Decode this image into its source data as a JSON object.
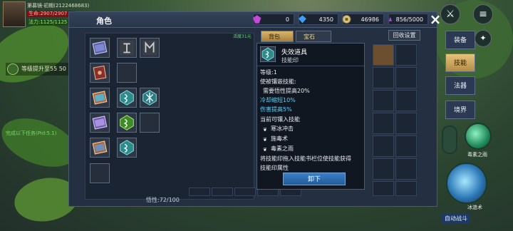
{
  "hud": {
    "player_name": "第募镜·初期(2122468683)",
    "hp_text": "生命:2907/2907",
    "mp_text": "法力:1125/1125",
    "quest_upgrade": "等级提升至55 50",
    "quest_green": "完成以下任务(Pid:5.1)"
  },
  "panel": {
    "title": "角色",
    "insight": "悟性:72/100"
  },
  "currency": [
    {
      "icon": "purple-gem-icon",
      "value": "0",
      "color": "#c24ad8"
    },
    {
      "icon": "blue-diamond-icon",
      "value": "4350",
      "color": "#3aa0ff"
    },
    {
      "icon": "coin-icon",
      "value": "46986",
      "color": "#d8c27a"
    },
    {
      "icon": "purple-crystal-icon",
      "value": "856/5000",
      "color": "#b04ce0"
    }
  ],
  "tabs": {
    "level_req": "活度31元",
    "bag": "背包",
    "gem": "宝石",
    "recycle": "回收设置"
  },
  "side_tabs": [
    "装备",
    "技能",
    "法器",
    "境界"
  ],
  "tooltip": {
    "name": "失效道具",
    "subtitle": "技能印",
    "level": "等级:1",
    "effect_header": "使被镶嵌技能:",
    "effect_1": "需要悟性提高20%",
    "effect_2": "冷却缩短10%",
    "effect_3": "伤害提高5%",
    "inlay_header": "当前可镶入技能",
    "skills": [
      "寒冰冲击",
      "施毒术",
      "毒素之雨"
    ],
    "hint_1": "将技能印拖入技能书栏位使技能获得",
    "hint_2": "技能印属性",
    "unequip": "卸下"
  },
  "right_hud": {
    "skill_1": "毒素之雨",
    "skill_2": "冰涟术",
    "auto_battle": "自动战斗"
  }
}
